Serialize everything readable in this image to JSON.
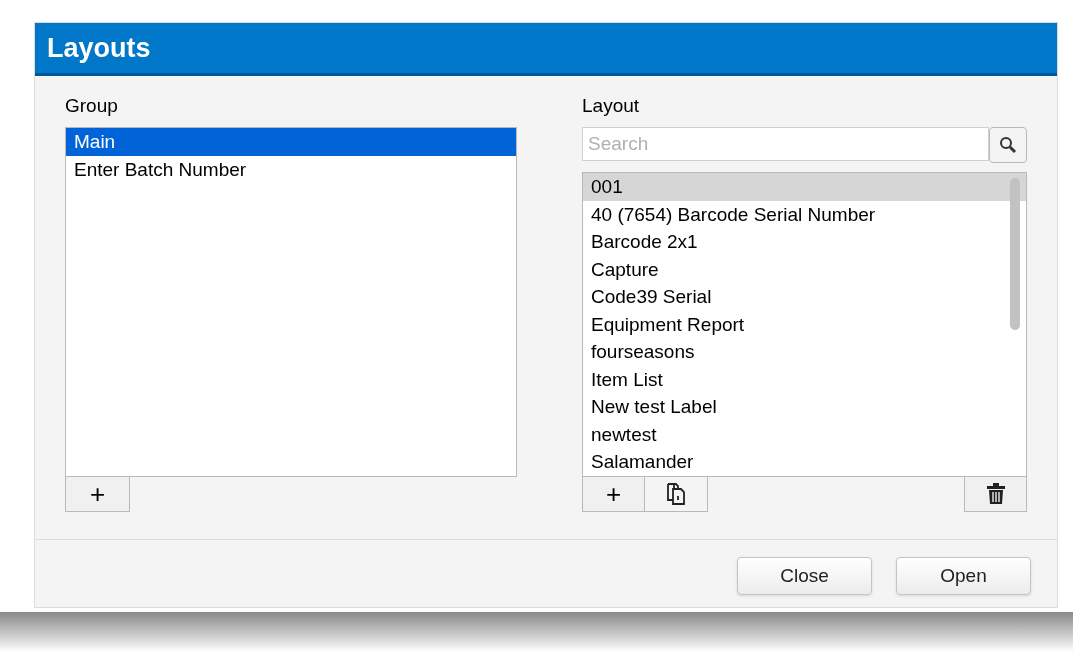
{
  "window": {
    "title": "Layouts"
  },
  "group": {
    "label": "Group",
    "focused": true,
    "items": [
      {
        "label": "Main",
        "selected": true
      },
      {
        "label": "Enter Batch Number",
        "selected": false
      }
    ]
  },
  "layout": {
    "label": "Layout",
    "search": {
      "placeholder": "Search"
    },
    "focused": false,
    "items": [
      {
        "label": "001",
        "selected": true
      },
      {
        "label": "40 (7654) Barcode Serial Number",
        "selected": false
      },
      {
        "label": "Barcode 2x1",
        "selected": false
      },
      {
        "label": "Capture",
        "selected": false
      },
      {
        "label": "Code39 Serial",
        "selected": false
      },
      {
        "label": "Equipment Report",
        "selected": false
      },
      {
        "label": "fourseasons",
        "selected": false
      },
      {
        "label": "Item List",
        "selected": false
      },
      {
        "label": "New test Label",
        "selected": false
      },
      {
        "label": "newtest",
        "selected": false
      },
      {
        "label": "Salamander",
        "selected": false
      }
    ]
  },
  "group_add_button": "+",
  "layout_add_button": "+",
  "buttons": [
    "Close",
    "Open"
  ]
}
